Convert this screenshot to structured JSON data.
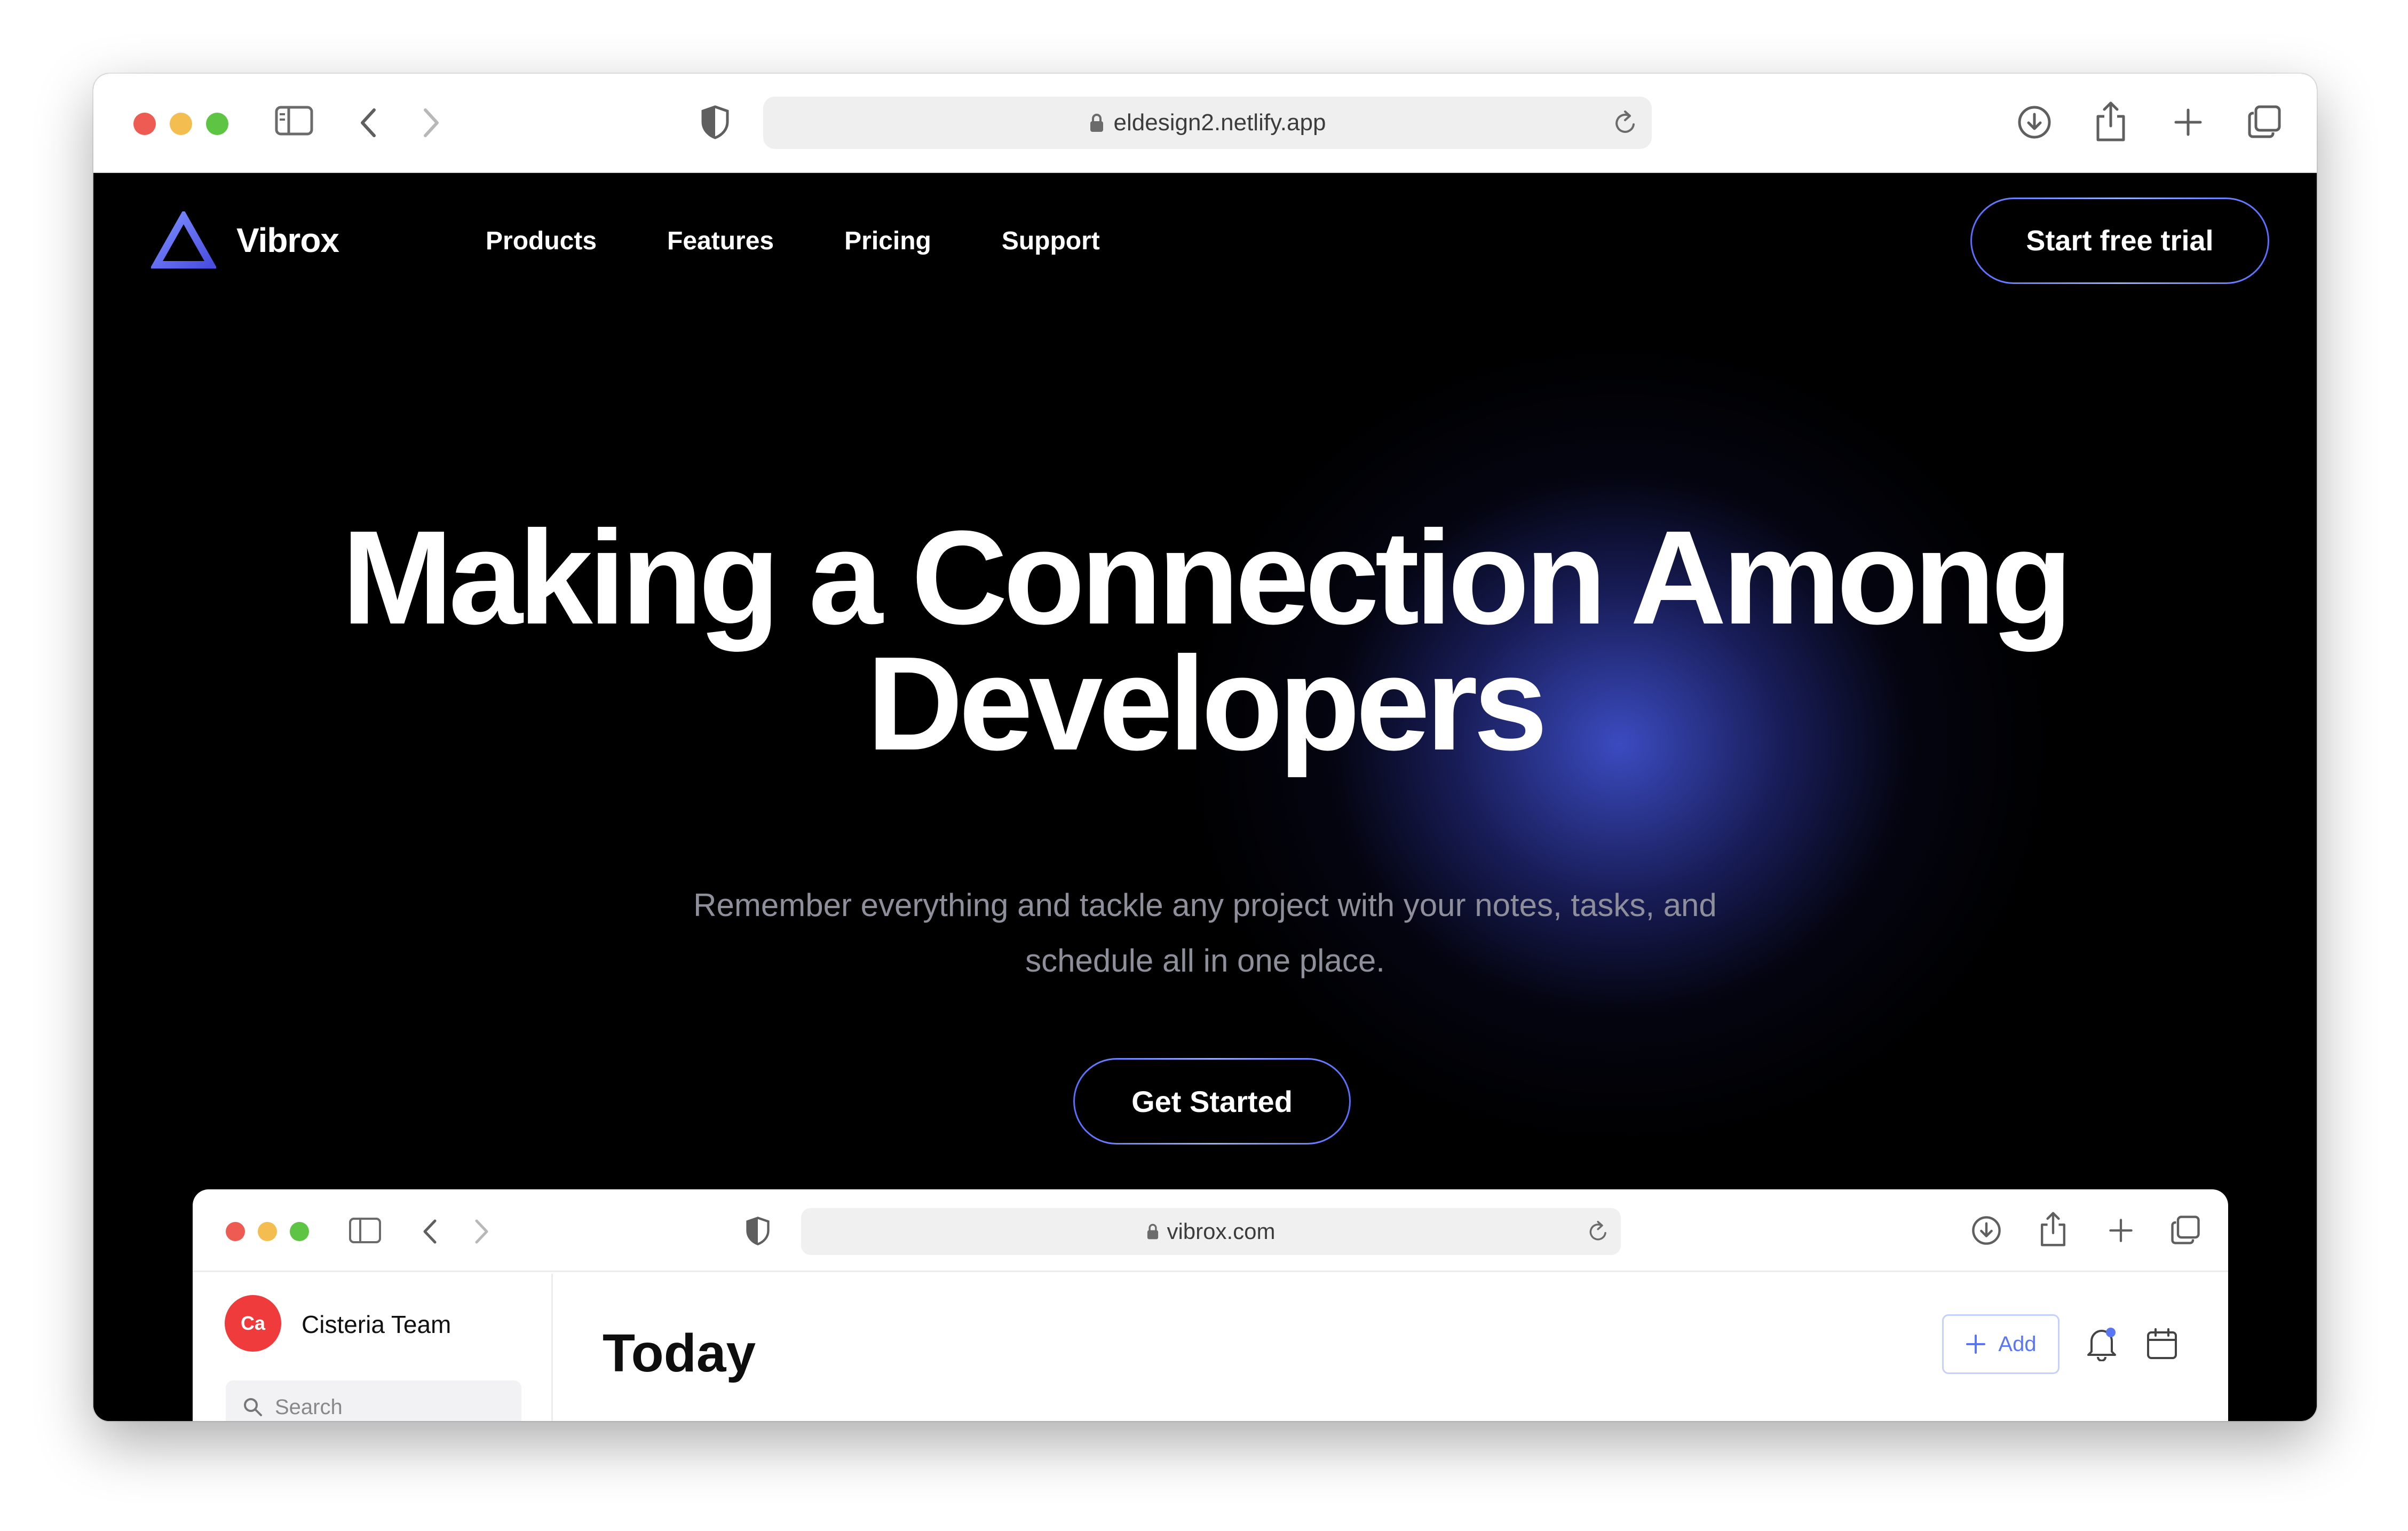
{
  "browser": {
    "url": "eldesign2.netlify.app"
  },
  "site": {
    "logo_name": "Vibrox",
    "nav": [
      "Products",
      "Features",
      "Pricing",
      "Support"
    ],
    "cta_label": "Start free trial",
    "hero": {
      "title_line1": "Making a Connection Among",
      "title_line2": "Developers",
      "subtitle_line1": "Remember everything and tackle any project with your notes, tasks, and",
      "subtitle_line2": "schedule all in one place.",
      "button_label": "Get Started"
    },
    "colors": {
      "accent": "#5a6cff",
      "glow": "#485ceb",
      "background": "#000000"
    }
  },
  "preview": {
    "url": "vibrox.com",
    "team_name": "Cisteria Team",
    "team_avatar_text": "Ca",
    "search_placeholder": "Search",
    "page_title": "Today",
    "add_label": "Add",
    "add_color": "#5b76f5"
  }
}
